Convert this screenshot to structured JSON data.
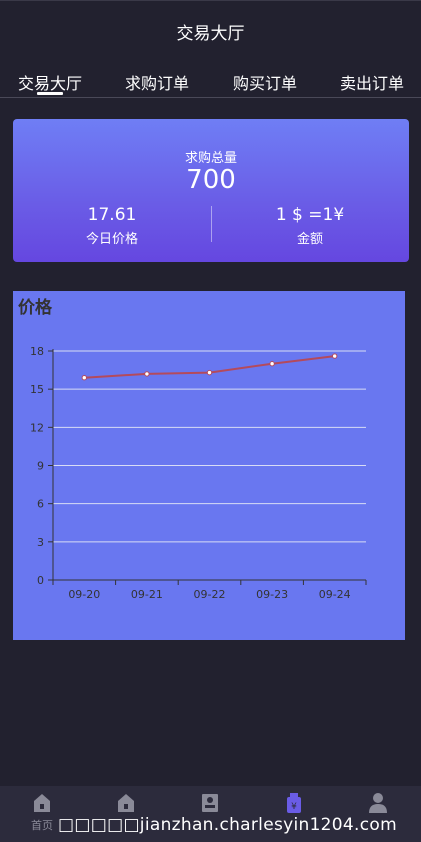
{
  "header": {
    "title": "交易大厅"
  },
  "tabs": [
    {
      "label": "交易大厅",
      "active": true
    },
    {
      "label": "求购订单",
      "active": false
    },
    {
      "label": "购买订单",
      "active": false
    },
    {
      "label": "卖出订单",
      "active": false
    }
  ],
  "summary": {
    "total_label": "求购总量",
    "total_value": "700",
    "price_value": "17.61",
    "price_label": "今日价格",
    "rate_value": "1 $ =1¥",
    "rate_label": "金额"
  },
  "colors": {
    "background": "#22212f",
    "card_gradient_top": "#6f7ef5",
    "card_gradient_bottom": "#6547e0",
    "chart_background": "#6977f0",
    "line": "#b44a5c",
    "accent": "#6a5ce6"
  },
  "chart_data": {
    "type": "line",
    "title": "价格",
    "categories": [
      "09-20",
      "09-21",
      "09-22",
      "09-23",
      "09-24"
    ],
    "values": [
      15.9,
      16.2,
      16.3,
      17.0,
      17.6
    ],
    "ylim": [
      0,
      18
    ],
    "yticks": [
      0,
      3,
      6,
      9,
      12,
      15,
      18
    ],
    "grid": true,
    "xlabel": "",
    "ylabel": ""
  },
  "bottom_nav": [
    {
      "label": "首页",
      "icon": "home-icon",
      "active": false
    },
    {
      "label": "",
      "icon": "home-icon",
      "active": false
    },
    {
      "label": "",
      "icon": "user-card-icon",
      "active": false
    },
    {
      "label": "",
      "icon": "money-bag-icon",
      "active": true
    },
    {
      "label": "",
      "icon": "person-icon",
      "active": false
    }
  ],
  "watermark": "□□□□□jianzhan.charlesyin1204.com"
}
